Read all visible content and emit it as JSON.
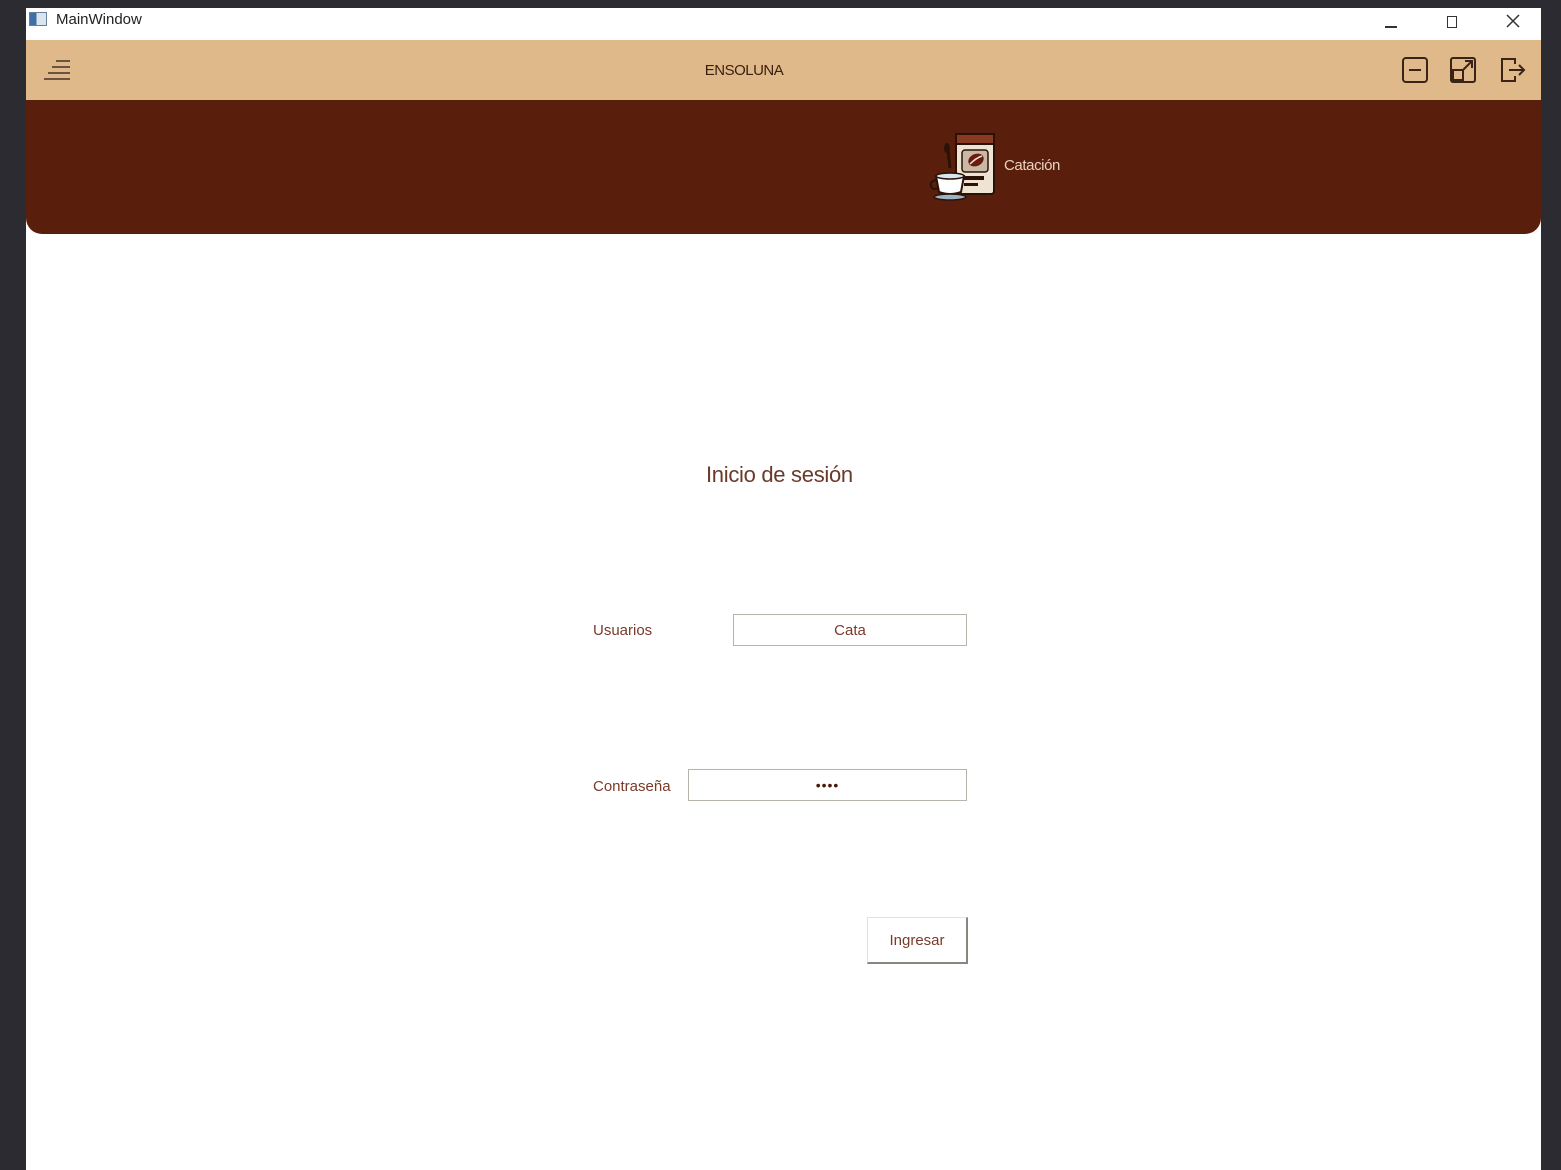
{
  "window": {
    "title": "MainWindow"
  },
  "header": {
    "app_name": "ENSOLUNA"
  },
  "banner": {
    "catacion_label": "Catación"
  },
  "login": {
    "title": "Inicio de sesión",
    "user_label": "Usuarios",
    "user_value": "Cata",
    "password_label": "Contraseña",
    "password_value": "••••",
    "submit_label": "Ingresar"
  },
  "colors": {
    "header_bg": "#dfb989",
    "banner_bg": "#5a1e0c",
    "label_text": "#7a3a2a"
  }
}
